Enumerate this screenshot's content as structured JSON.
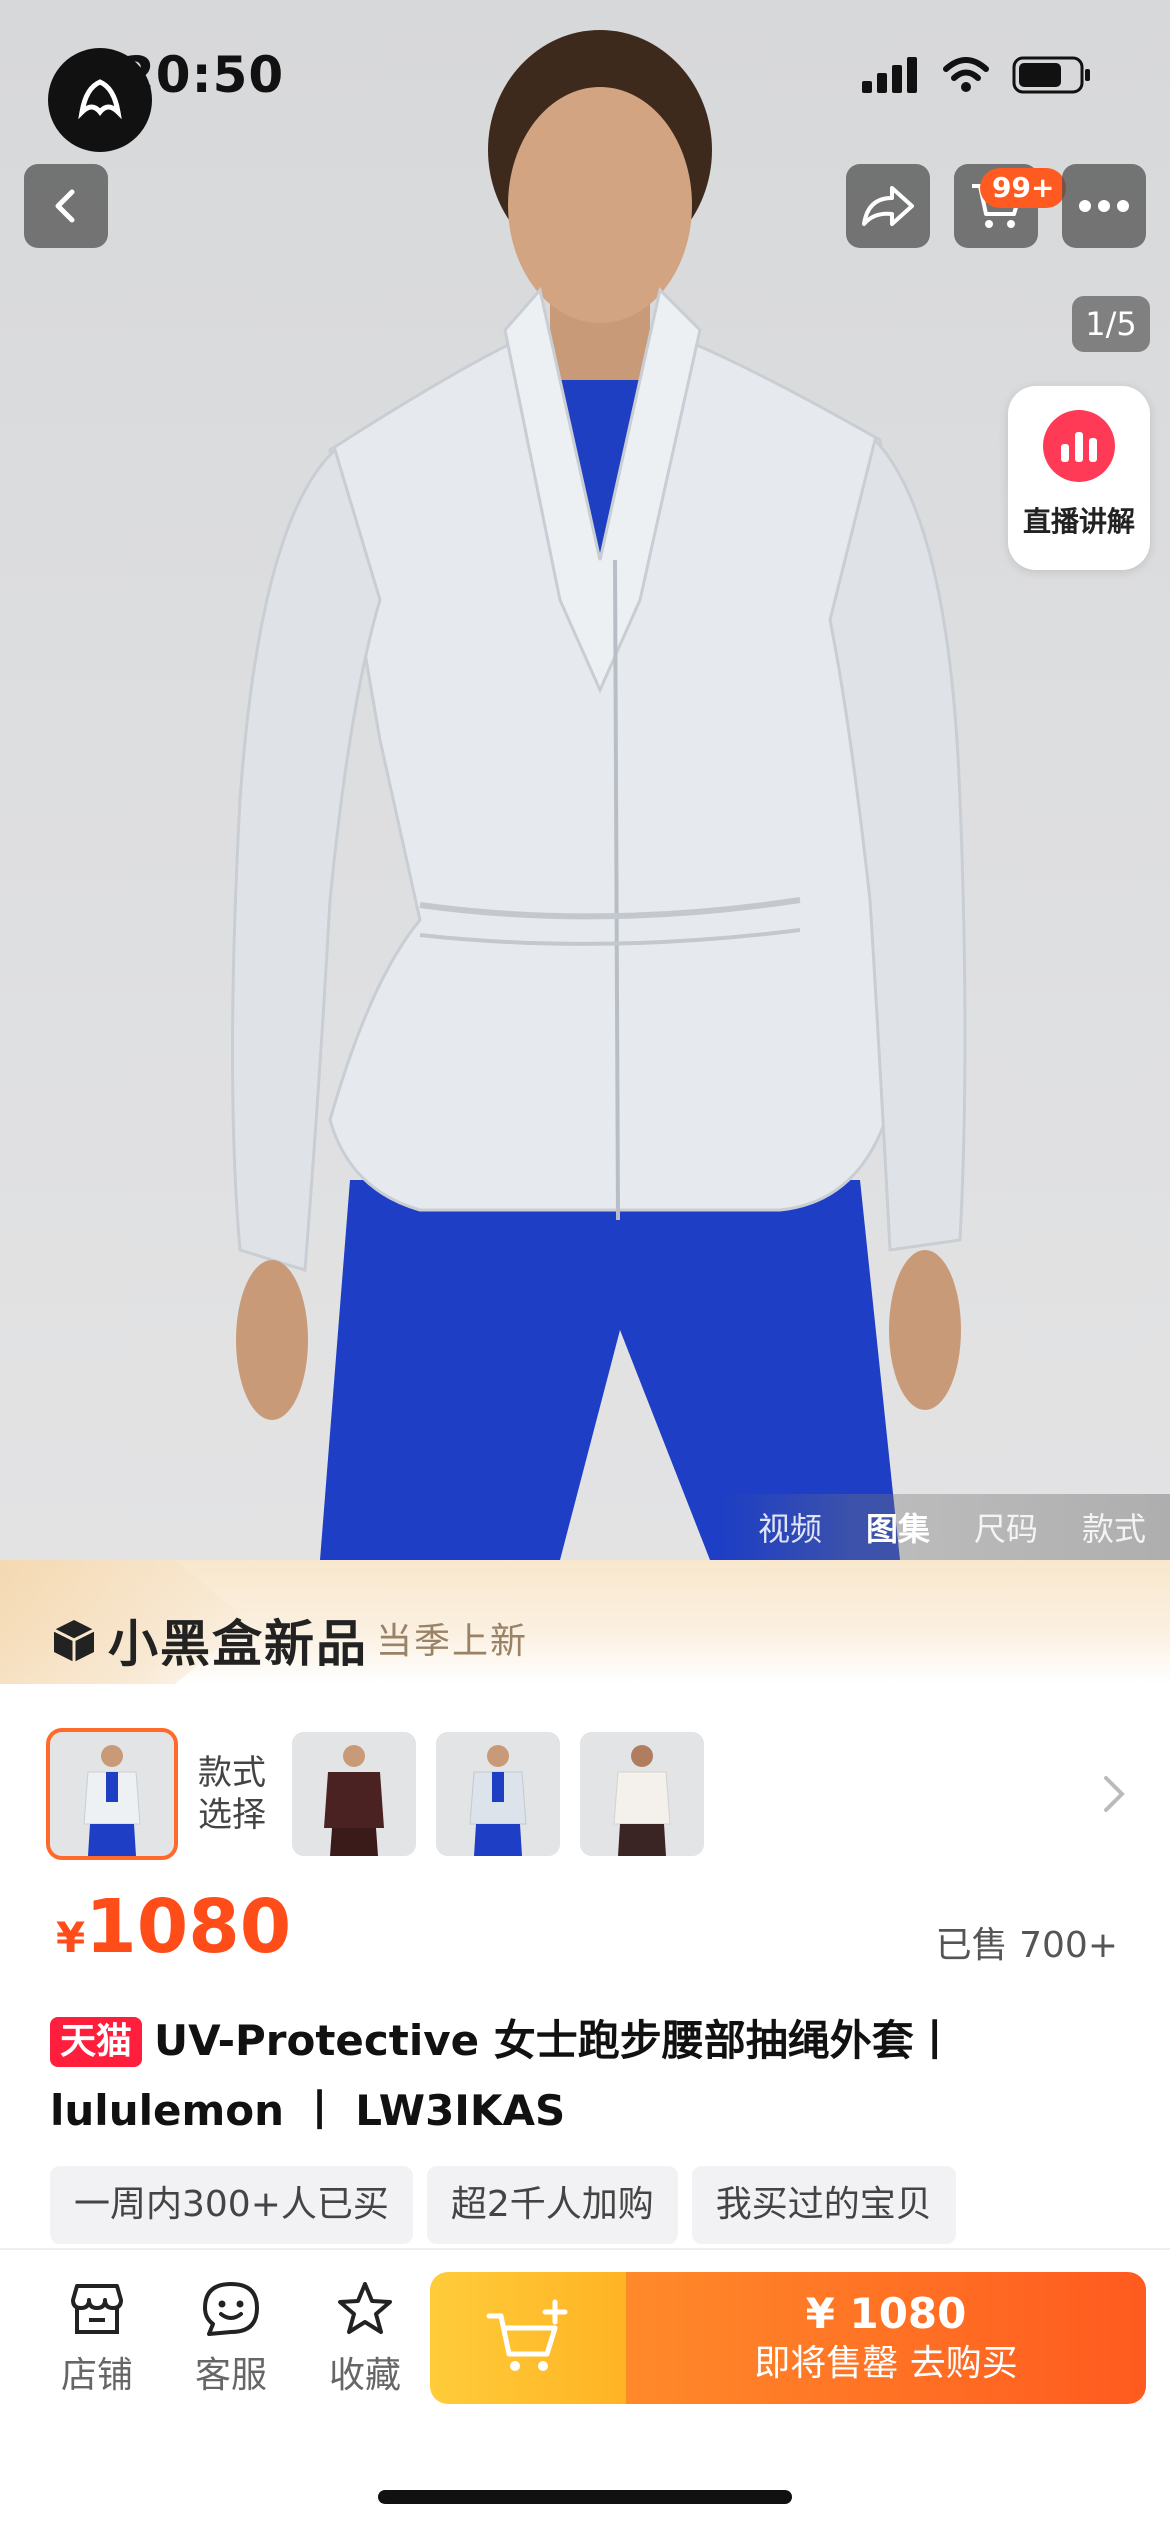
{
  "status_bar": {
    "time": "20:50"
  },
  "gallery": {
    "page_indicator": "1/5",
    "live_label": "直播讲解",
    "tabs": [
      "视频",
      "图集",
      "尺码",
      "款式"
    ],
    "active_tab": "图集"
  },
  "header": {
    "cart_badge": "99+"
  },
  "promo": {
    "title": "小黑盒新品",
    "subtitle": "当季上新"
  },
  "variants": {
    "label_line1": "款式",
    "label_line2": "选择",
    "selected_index": 0
  },
  "price": {
    "currency": "¥",
    "amount": "1080",
    "sold": "已售 700+"
  },
  "product": {
    "store_badge": "天猫",
    "title": "UV-Protective 女士跑步腰部抽绳外套丨lululemon 丨 LW3IKAS"
  },
  "tags": [
    "一周内300+人已买",
    "超2千人加购",
    "我买过的宝贝"
  ],
  "bottom_bar": {
    "items": [
      {
        "label": "店铺",
        "icon": "store-icon"
      },
      {
        "label": "客服",
        "icon": "chat-smile-icon"
      },
      {
        "label": "收藏",
        "icon": "star-icon"
      }
    ],
    "buy_price": "¥ 1080",
    "buy_label": "即将售罄  去购买"
  },
  "colors": {
    "accent": "#ff5a1f",
    "price": "#ff4d1a",
    "tmall": "#ff1f3d",
    "cart_button": "#ffc12e"
  }
}
